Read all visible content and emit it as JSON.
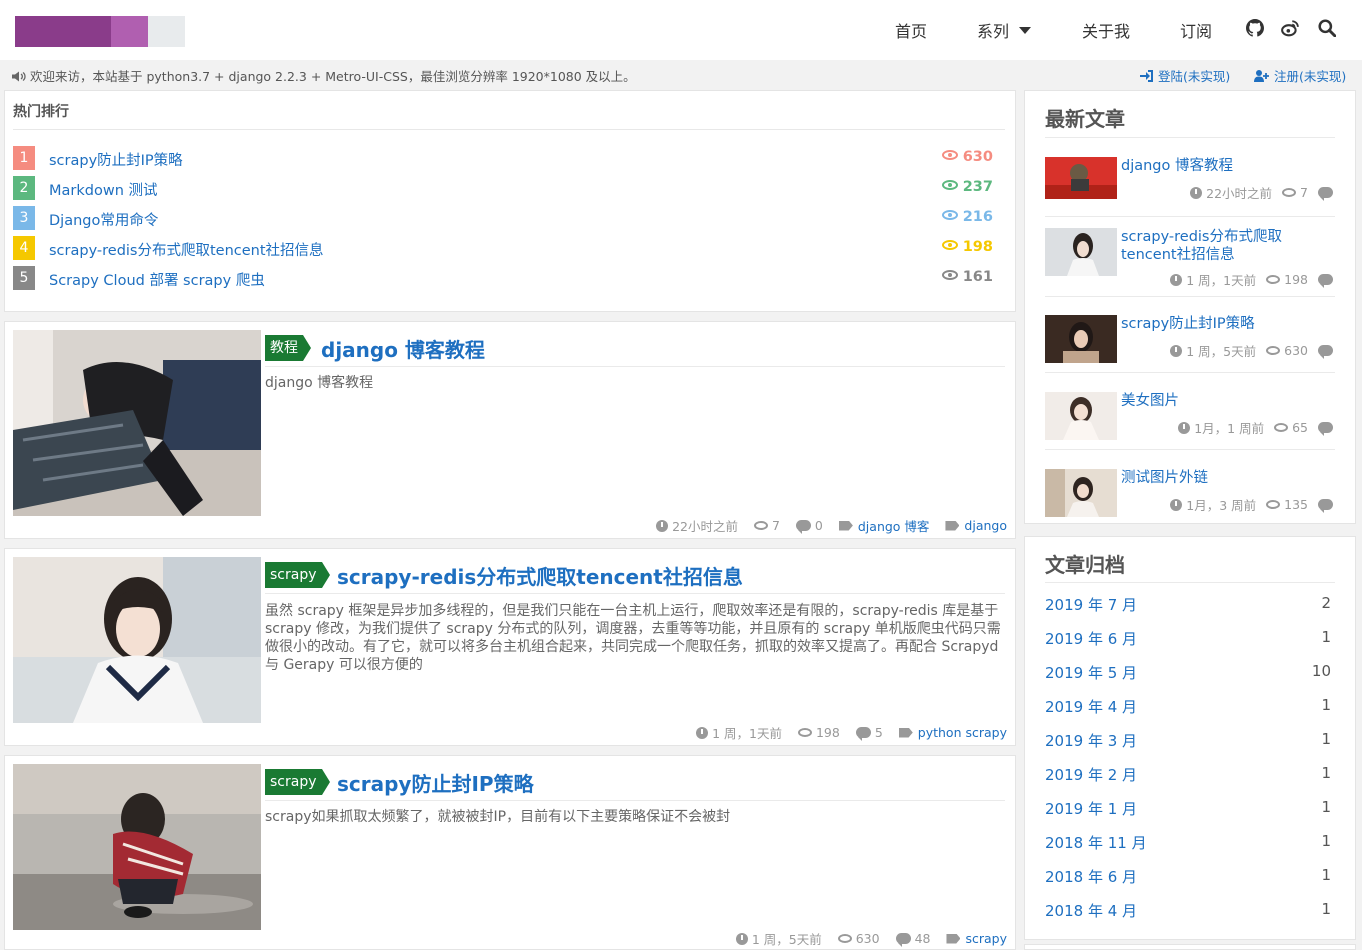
{
  "nav": {
    "home": "首页",
    "series": "系列",
    "about": "关于我",
    "subscribe": "订阅",
    "icons": [
      "github-icon",
      "weibo-icon",
      "search-icon"
    ]
  },
  "notice": {
    "message": "欢迎来访，本站基于 python3.7 + django 2.2.3 + Metro-UI-CSS，最佳浏览分辨率 1920*1080 及以上。",
    "login": "登陆(未实现)",
    "register": "注册(未实现)"
  },
  "hot": {
    "title": "热门排行",
    "items": [
      {
        "rank": "1",
        "title": "scrapy防止封IP策略",
        "count": "630",
        "color": "#f58c80"
      },
      {
        "rank": "2",
        "title": "Markdown 测试",
        "count": "237",
        "color": "#5cb87f"
      },
      {
        "rank": "3",
        "title": "Django常用命令",
        "count": "216",
        "color": "#7ab8e8"
      },
      {
        "rank": "4",
        "title": "scrapy-redis分布式爬取tencent社招信息",
        "count": "198",
        "color": "#f5c800"
      },
      {
        "rank": "5",
        "title": "Scrapy Cloud 部署 scrapy 爬虫",
        "count": "161",
        "color": "#888888"
      }
    ]
  },
  "articles": [
    {
      "tag": "教程",
      "title": "django 博客教程",
      "summary": "django 博客教程",
      "time": "22小时之前",
      "views": "7",
      "comments": "0",
      "tags": [
        "django 博客",
        "django"
      ]
    },
    {
      "tag": "scrapy",
      "title": "scrapy-redis分布式爬取tencent社招信息",
      "summary": "虽然 scrapy 框架是异步加多线程的，但是我们只能在一台主机上运行，爬取效率还是有限的，scrapy-redis 库是基于 scrapy 修改，为我们提供了 scrapy 分布式的队列，调度器，去重等等功能，并且原有的 scrapy 单机版爬虫代码只需做很小的改动。有了它，就可以将多台主机组合起来，共同完成一个爬取任务，抓取的效率又提高了。再配合 Scrapyd 与 Gerapy 可以很方便的",
      "time": "1 周，1天前",
      "views": "198",
      "comments": "5",
      "tags": [
        "python scrapy"
      ]
    },
    {
      "tag": "scrapy",
      "title": "scrapy防止封IP策略",
      "summary": "scrapy如果抓取太频繁了，就被被封IP，目前有以下主要策略保证不会被封",
      "time": "1 周，5天前",
      "views": "630",
      "comments": "48",
      "tags": [
        "scrapy"
      ]
    }
  ],
  "latest": {
    "title": "最新文章",
    "items": [
      {
        "title": "django 博客教程",
        "time": "22小时之前",
        "views": "7"
      },
      {
        "title": "scrapy-redis分布式爬取tencent社招信息",
        "time": "1 周，1天前",
        "views": "198"
      },
      {
        "title": "scrapy防止封IP策略",
        "time": "1 周，5天前",
        "views": "630"
      },
      {
        "title": "美女图片",
        "time": "1月，1 周前",
        "views": "65"
      },
      {
        "title": "测试图片外链",
        "time": "1月，3 周前",
        "views": "135"
      }
    ]
  },
  "archive": {
    "title": "文章归档",
    "items": [
      {
        "label": "2019 年 7 月",
        "count": "2"
      },
      {
        "label": "2019 年 6 月",
        "count": "1"
      },
      {
        "label": "2019 年 5 月",
        "count": "10"
      },
      {
        "label": "2019 年 4 月",
        "count": "1"
      },
      {
        "label": "2019 年 3 月",
        "count": "1"
      },
      {
        "label": "2019 年 2 月",
        "count": "1"
      },
      {
        "label": "2019 年 1 月",
        "count": "1"
      },
      {
        "label": "2018 年 11 月",
        "count": "1"
      },
      {
        "label": "2018 年 6 月",
        "count": "1"
      },
      {
        "label": "2018 年 4 月",
        "count": "1"
      }
    ]
  },
  "colors": {
    "accent": "#1e6fc0",
    "tag_green": "#1a7a33",
    "logo_purple": "#8a3c8a"
  }
}
